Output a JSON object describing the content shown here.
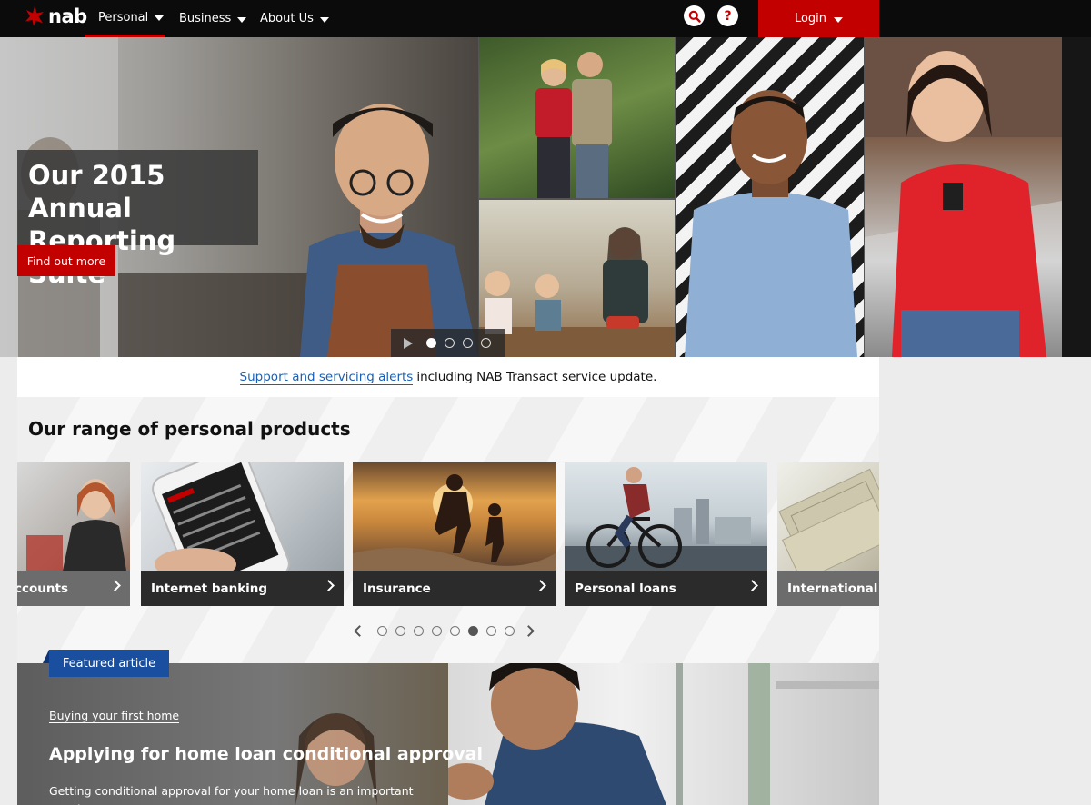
{
  "header": {
    "logo_text": "nab",
    "nav": [
      {
        "label": "Personal"
      },
      {
        "label": "Business"
      },
      {
        "label": "About Us"
      }
    ],
    "help_symbol": "?",
    "login_label": "Login",
    "icons": [
      "star-logo-icon",
      "search-icon",
      "help-icon",
      "caret-down-icon"
    ]
  },
  "hero": {
    "headline": "Our 2015 Annual Reporting Suite",
    "cta_label": "Find out more",
    "slides_total": 4,
    "active_slide": 1
  },
  "alert": {
    "link_text": "Support and servicing alerts",
    "text": "including NAB Transact service update."
  },
  "products": {
    "title": "Our range of personal products",
    "cards": [
      {
        "label": "ccounts"
      },
      {
        "label": "Internet banking"
      },
      {
        "label": "Insurance"
      },
      {
        "label": "Personal loans"
      },
      {
        "label": "International"
      }
    ],
    "pages_total": 8,
    "active_page": 6
  },
  "featured": {
    "tag": "Featured article",
    "kicker": "Buying your first home",
    "title": "Applying for home loan conditional approval",
    "description": "Getting conditional approval for your home loan is an important step in"
  },
  "colors": {
    "brand_red": "#c20000",
    "topbar": "#0b0b0b",
    "link_blue": "#1a5fb4",
    "featured_blue": "#1a4fa0"
  }
}
